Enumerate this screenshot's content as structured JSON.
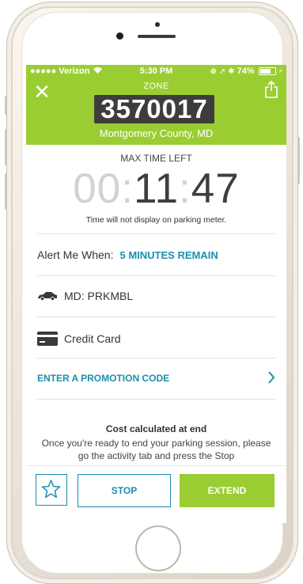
{
  "status_bar": {
    "carrier": "●●●●● Verizon",
    "time": "5:30 PM",
    "battery": "74%"
  },
  "header": {
    "zone_label": "ZONE",
    "zone_number": "3570017",
    "county": "Montgomery County, MD"
  },
  "timer": {
    "label": "MAX TIME LEFT",
    "hours": "00",
    "sep1": ":",
    "minutes": "11",
    "sep2": ":",
    "seconds": "47",
    "note": "Time will not display on parking meter."
  },
  "alert": {
    "label": "Alert Me When:",
    "value": "5 MINUTES REMAIN"
  },
  "vehicle": {
    "text": "MD: PRKMBL"
  },
  "payment": {
    "text": "Credit Card"
  },
  "promo": {
    "text": "ENTER A PROMOTION CODE"
  },
  "cost": {
    "title": "Cost calculated at end",
    "description": "Once you're ready to end your parking session, please go the activity tab and press the Stop"
  },
  "footer": {
    "stop_label": "STOP",
    "extend_label": "EXTEND"
  },
  "colors": {
    "brand_green": "#9acd32",
    "accent_blue": "#1b8fae"
  }
}
